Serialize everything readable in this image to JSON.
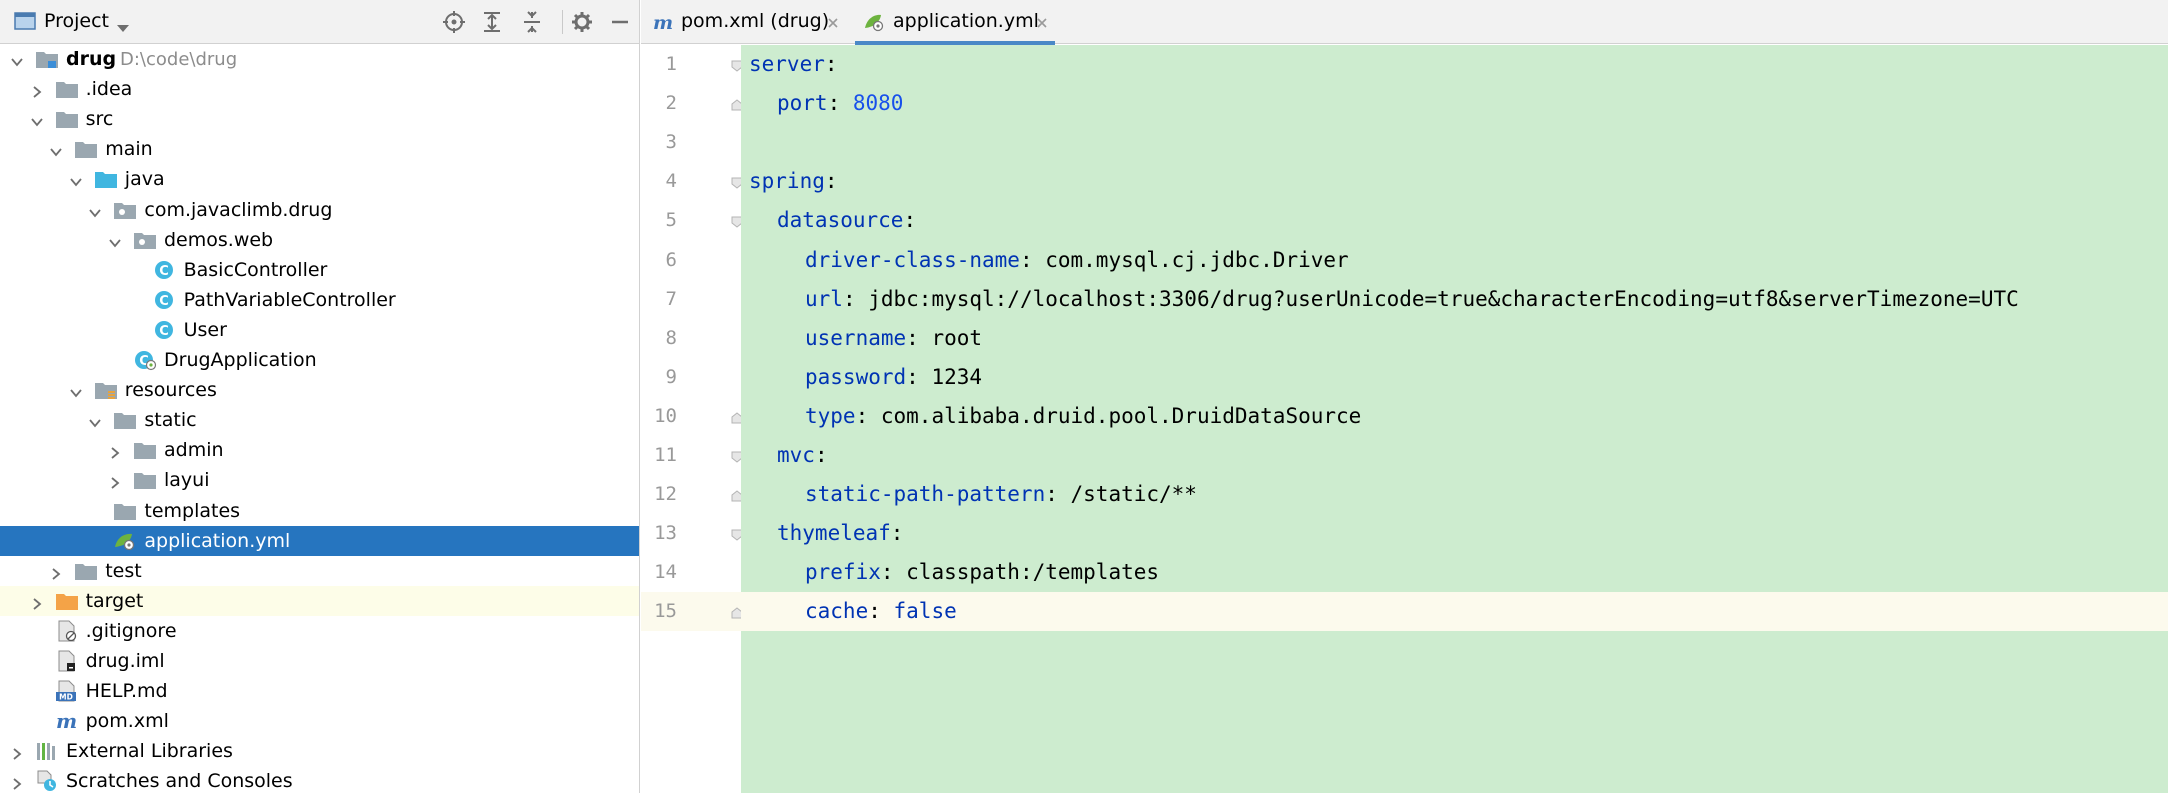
{
  "project_panel": {
    "title": "Project",
    "tree": [
      {
        "label": "drug",
        "path": "D:\\code\\drug",
        "depth": 0,
        "expanded": true,
        "icon": "module-folder-icon",
        "bold": true
      },
      {
        "label": ".idea",
        "depth": 1,
        "expanded": false,
        "icon": "folder-icon"
      },
      {
        "label": "src",
        "depth": 1,
        "expanded": true,
        "icon": "folder-icon"
      },
      {
        "label": "main",
        "depth": 2,
        "expanded": true,
        "icon": "folder-icon"
      },
      {
        "label": "java",
        "depth": 3,
        "expanded": true,
        "icon": "source-folder-icon"
      },
      {
        "label": "com.javaclimb.drug",
        "depth": 4,
        "expanded": true,
        "icon": "package-icon"
      },
      {
        "label": "demos.web",
        "depth": 5,
        "expanded": true,
        "icon": "package-icon"
      },
      {
        "label": "BasicController",
        "depth": 6,
        "icon": "class-icon"
      },
      {
        "label": "PathVariableController",
        "depth": 6,
        "icon": "class-icon"
      },
      {
        "label": "User",
        "depth": 6,
        "icon": "class-icon"
      },
      {
        "label": "DrugApplication",
        "depth": 5,
        "icon": "spring-app-class-icon"
      },
      {
        "label": "resources",
        "depth": 3,
        "expanded": true,
        "icon": "resources-folder-icon"
      },
      {
        "label": "static",
        "depth": 4,
        "expanded": true,
        "icon": "folder-icon"
      },
      {
        "label": "admin",
        "depth": 5,
        "expanded": false,
        "icon": "folder-icon"
      },
      {
        "label": "layui",
        "depth": 5,
        "expanded": false,
        "icon": "folder-icon"
      },
      {
        "label": "templates",
        "depth": 4,
        "icon": "folder-icon"
      },
      {
        "label": "application.yml",
        "depth": 4,
        "icon": "spring-yml-icon",
        "selected": true
      },
      {
        "label": "test",
        "depth": 2,
        "expanded": false,
        "icon": "folder-icon"
      },
      {
        "label": "target",
        "depth": 1,
        "expanded": false,
        "icon": "excluded-folder-icon",
        "excluded": true
      },
      {
        "label": ".gitignore",
        "depth": 1,
        "icon": "gitignore-file-icon"
      },
      {
        "label": "drug.iml",
        "depth": 1,
        "icon": "iml-file-icon"
      },
      {
        "label": "HELP.md",
        "depth": 1,
        "icon": "markdown-file-icon"
      },
      {
        "label": "pom.xml",
        "depth": 1,
        "icon": "maven-file-icon"
      },
      {
        "label": "External Libraries",
        "depth": 0,
        "expanded": false,
        "icon": "libraries-icon"
      },
      {
        "label": "Scratches and Consoles",
        "depth": 0,
        "expanded": false,
        "icon": "scratches-icon"
      }
    ]
  },
  "editor": {
    "tabs": [
      {
        "label": "pom.xml (drug)",
        "icon": "maven-file-icon",
        "active": false
      },
      {
        "label": "application.yml",
        "icon": "spring-yml-icon",
        "active": true
      }
    ],
    "current_line": 15,
    "lines": [
      {
        "no": "1",
        "indent": 0,
        "key": "server",
        "sep": ":",
        "value": ""
      },
      {
        "no": "2",
        "indent": 1,
        "key": "port",
        "sep": ": ",
        "value": "8080",
        "vtype": "num"
      },
      {
        "no": "3",
        "indent": 0,
        "key": "",
        "sep": "",
        "value": ""
      },
      {
        "no": "4",
        "indent": 0,
        "key": "spring",
        "sep": ":",
        "value": ""
      },
      {
        "no": "5",
        "indent": 1,
        "key": "datasource",
        "sep": ":",
        "value": ""
      },
      {
        "no": "6",
        "indent": 2,
        "key": "driver-class-name",
        "sep": ": ",
        "value": "com.mysql.cj.jdbc.Driver",
        "vtype": "val"
      },
      {
        "no": "7",
        "indent": 2,
        "key": "url",
        "sep": ": ",
        "value": "jdbc:mysql://localhost:3306/drug?userUnicode=true&characterEncoding=utf8&serverTimezone=UTC",
        "vtype": "val"
      },
      {
        "no": "8",
        "indent": 2,
        "key": "username",
        "sep": ": ",
        "value": "root",
        "vtype": "val"
      },
      {
        "no": "9",
        "indent": 2,
        "key": "password",
        "sep": ": ",
        "value": "1234",
        "vtype": "val"
      },
      {
        "no": "10",
        "indent": 2,
        "key": "type",
        "sep": ": ",
        "value": "com.alibaba.druid.pool.DruidDataSource",
        "vtype": "val"
      },
      {
        "no": "11",
        "indent": 1,
        "key": "mvc",
        "sep": ":",
        "value": ""
      },
      {
        "no": "12",
        "indent": 2,
        "key": "static-path-pattern",
        "sep": ": ",
        "value": "/static/**",
        "vtype": "val"
      },
      {
        "no": "13",
        "indent": 1,
        "key": "thymeleaf",
        "sep": ":",
        "value": ""
      },
      {
        "no": "14",
        "indent": 2,
        "key": "prefix",
        "sep": ": ",
        "value": "classpath:/templates",
        "vtype": "val"
      },
      {
        "no": "15",
        "indent": 2,
        "key": "cache",
        "sep": ": ",
        "value": "false",
        "vtype": "kw"
      }
    ]
  },
  "colors": {
    "selection": "#2675bf",
    "code_background": "#cdeccf",
    "yaml_key": "#0033b3",
    "yaml_number": "#1750eb",
    "tab_underline": "#4a88c7"
  }
}
